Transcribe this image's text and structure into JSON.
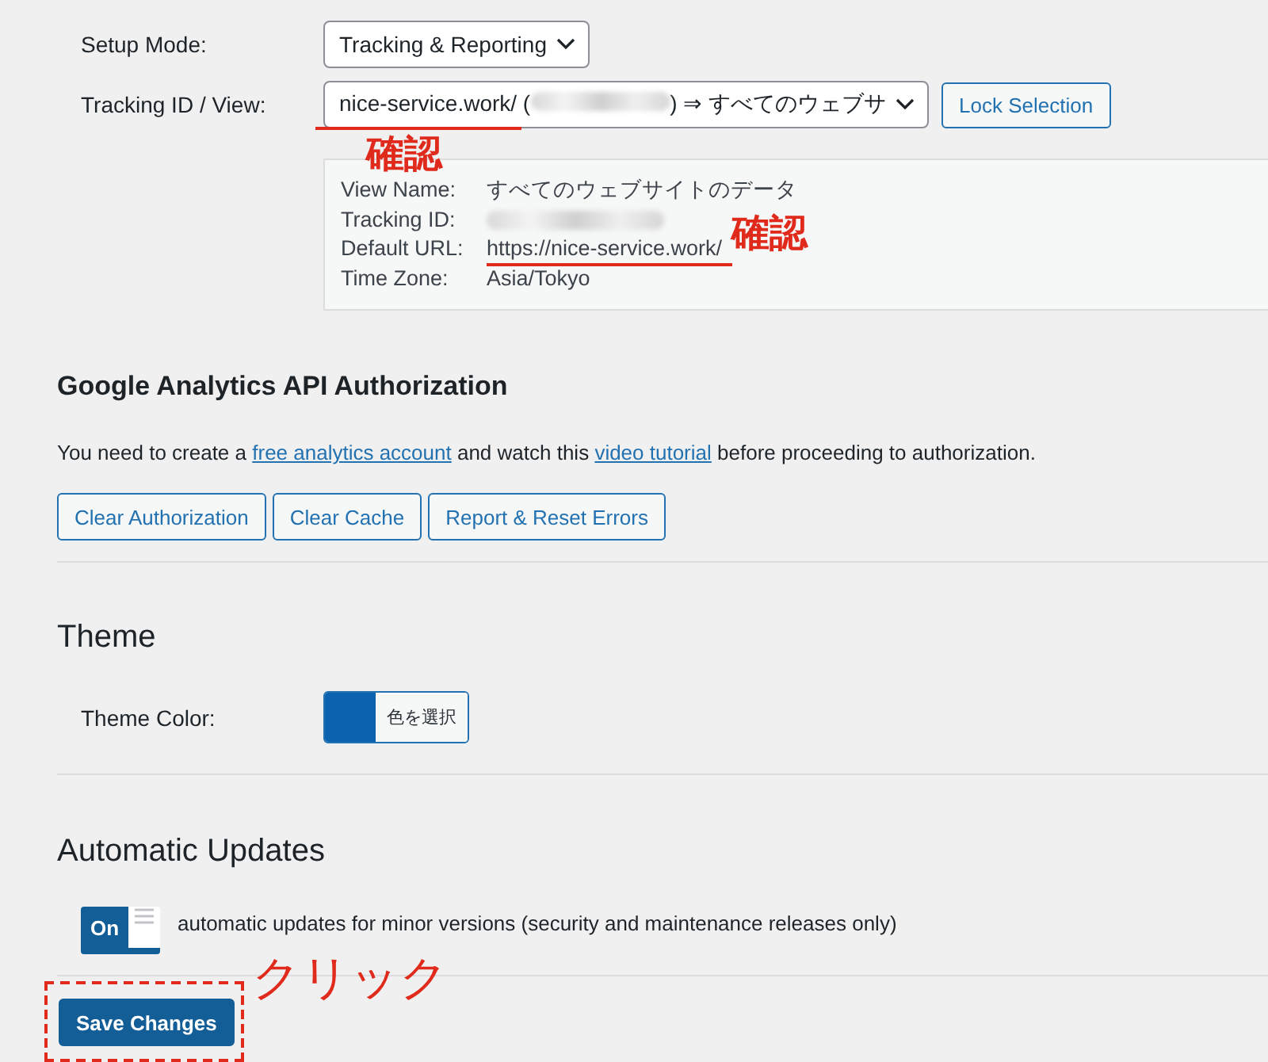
{
  "settings": [
    {
      "label": "Setup Mode:",
      "kind": "select",
      "value": "Tracking & Reporting"
    },
    {
      "label": "Tracking ID / View:",
      "kind": "select",
      "value_parts": [
        "nice-service.work/ (",
        ") ⇒ すべてのウェブサ"
      ],
      "redacted": true,
      "button": "Lock Selection",
      "note": "確認"
    }
  ],
  "view_info": [
    {
      "label": "View Name:",
      "value": "すべてのウェブサイトのデータ",
      "redacted": false
    },
    {
      "label": "Tracking ID:",
      "redacted": true
    },
    {
      "label": "Default URL:",
      "value": "https://nice-service.work/",
      "redacted": false,
      "note": "確認"
    },
    {
      "label": "Time Zone:",
      "value": "Asia/Tokyo",
      "redacted": false
    }
  ],
  "authorization": {
    "title": "Google Analytics API Authorization",
    "text_parts": [
      "You need to create a ",
      "free analytics account",
      " and watch this ",
      "video tutorial",
      " before proceeding to authorization."
    ],
    "buttons": [
      "Clear Authorization",
      "Clear Cache",
      "Report & Reset Errors"
    ]
  },
  "theme": {
    "title": "Theme",
    "label": "Theme Color:",
    "color": "#0b63b0",
    "picker_button": "色を選択"
  },
  "updates": {
    "title": "Automatic Updates",
    "toggle_label": "On",
    "on": true,
    "text": "automatic updates for minor versions (security and maintenance releases only)"
  },
  "save": {
    "label": "Save Changes",
    "note": "クリック"
  }
}
